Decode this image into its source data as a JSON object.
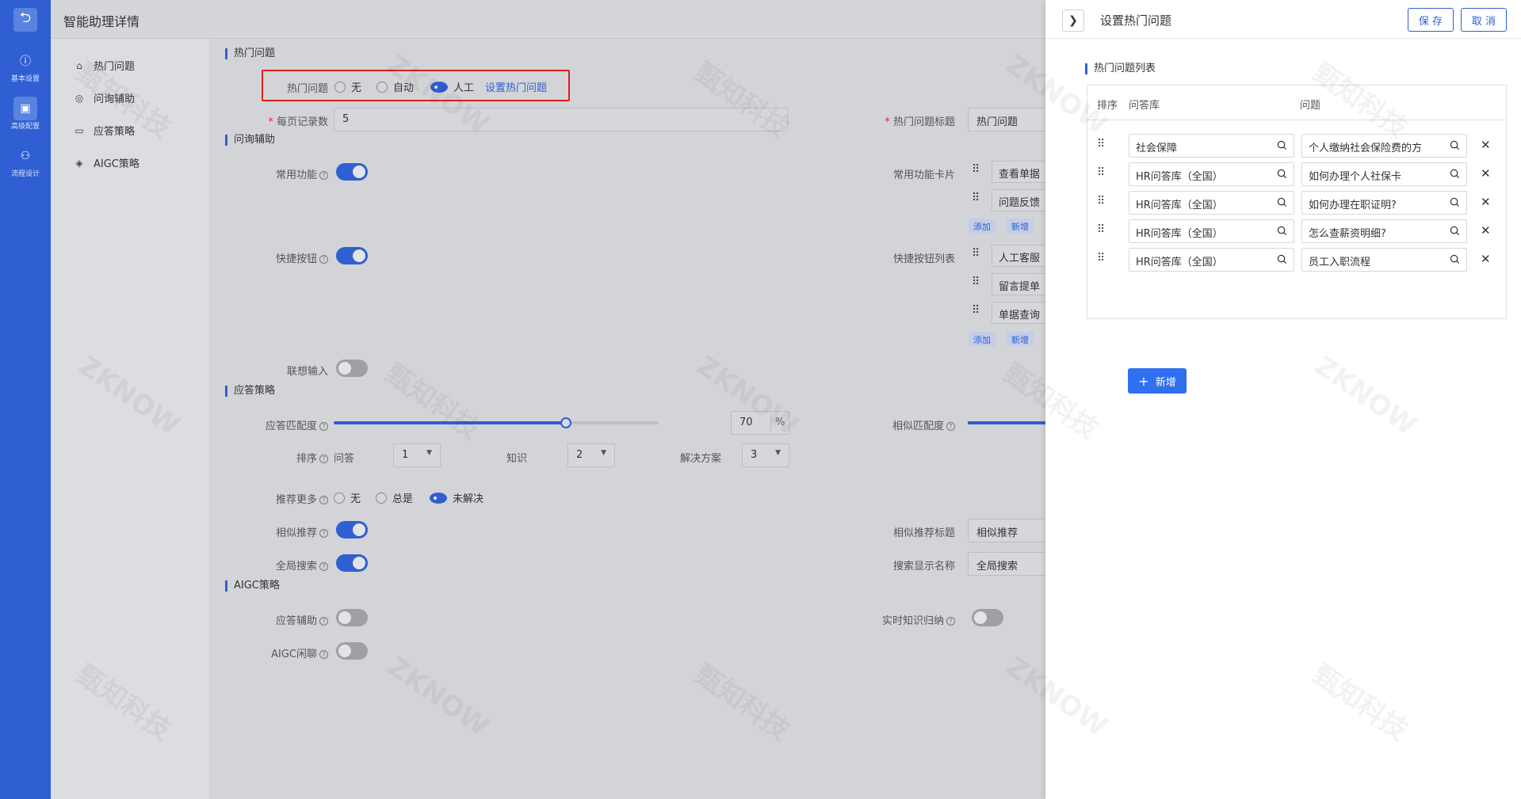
{
  "nav": {
    "back_icon": "undo-icon",
    "items": [
      {
        "label": "基本设置",
        "icon": "info-icon"
      },
      {
        "label": "高级配置",
        "icon": "config-icon"
      },
      {
        "label": "流程设计",
        "icon": "flow-icon"
      }
    ]
  },
  "header": {
    "title": "智能助理详情"
  },
  "subnav": {
    "items": [
      {
        "label": "热门问题",
        "icon": "home-icon"
      },
      {
        "label": "问询辅助",
        "icon": "assist-icon"
      },
      {
        "label": "应答策略",
        "icon": "reply-icon"
      },
      {
        "label": "AIGC策略",
        "icon": "aigc-icon"
      }
    ]
  },
  "hot": {
    "section": "热门问题",
    "label": "热门问题",
    "options": [
      "无",
      "自动",
      "人工"
    ],
    "selected": "人工",
    "link": "设置热门问题",
    "per_page_label": "每页记录数",
    "per_page_value": "5",
    "title_label": "热门问题标题",
    "title_value": "热门问题"
  },
  "assist": {
    "section": "问询辅助",
    "common_label": "常用功能",
    "cards_label": "常用功能卡片",
    "cards": [
      "查看单据",
      "问题反馈"
    ],
    "add_label": "添加",
    "new_label": "新增",
    "quick_label": "快捷按钮",
    "quick_list_label": "快捷按钮列表",
    "quick": [
      "人工客服",
      "留言提单",
      "单据查询"
    ],
    "assoc_label": "联想输入"
  },
  "reply": {
    "section": "应答策略",
    "match_label": "应答匹配度",
    "match_value": "70",
    "match_unit": "%",
    "match_fraction": 0.7,
    "similar_match_label": "相似匹配度",
    "sort_label": "排序",
    "sort_items": [
      {
        "label": "问答",
        "value": "1"
      },
      {
        "label": "知识",
        "value": "2"
      },
      {
        "label": "解决方案",
        "value": "3"
      }
    ],
    "recommend_label": "推荐更多",
    "recommend_options": [
      "无",
      "总是",
      "未解决"
    ],
    "recommend_selected": "未解决",
    "similar_label": "相似推荐",
    "similar_title_label": "相似推荐标题",
    "similar_title_value": "相似推荐",
    "search_label": "全局搜索",
    "search_name_label": "搜索显示名称",
    "search_name_value": "全局搜索"
  },
  "aigc": {
    "section": "AIGC策略",
    "assist_label": "应答辅助",
    "chat_label": "AIGC闲聊",
    "realtime_label": "实时知识归纳"
  },
  "panel": {
    "title": "设置热门问题",
    "save": "保 存",
    "cancel": "取 消",
    "section": "热门问题列表",
    "col_sort": "排序",
    "col_lib": "问答库",
    "col_question": "问题",
    "rows": [
      {
        "lib": "社会保障",
        "question": "个人缴纳社会保险费的方"
      },
      {
        "lib": "HR问答库（全国）",
        "question": "如何办理个人社保卡"
      },
      {
        "lib": "HR问答库（全国）",
        "question": "如何办理在职证明?"
      },
      {
        "lib": "HR问答库（全国）",
        "question": "怎么查薪资明细?"
      },
      {
        "lib": "HR问答库（全国）",
        "question": "员工入职流程"
      }
    ],
    "add": "新增",
    "add_plus": "+"
  },
  "watermark": "甄知科技",
  "watermark_en": "ZKNOW"
}
